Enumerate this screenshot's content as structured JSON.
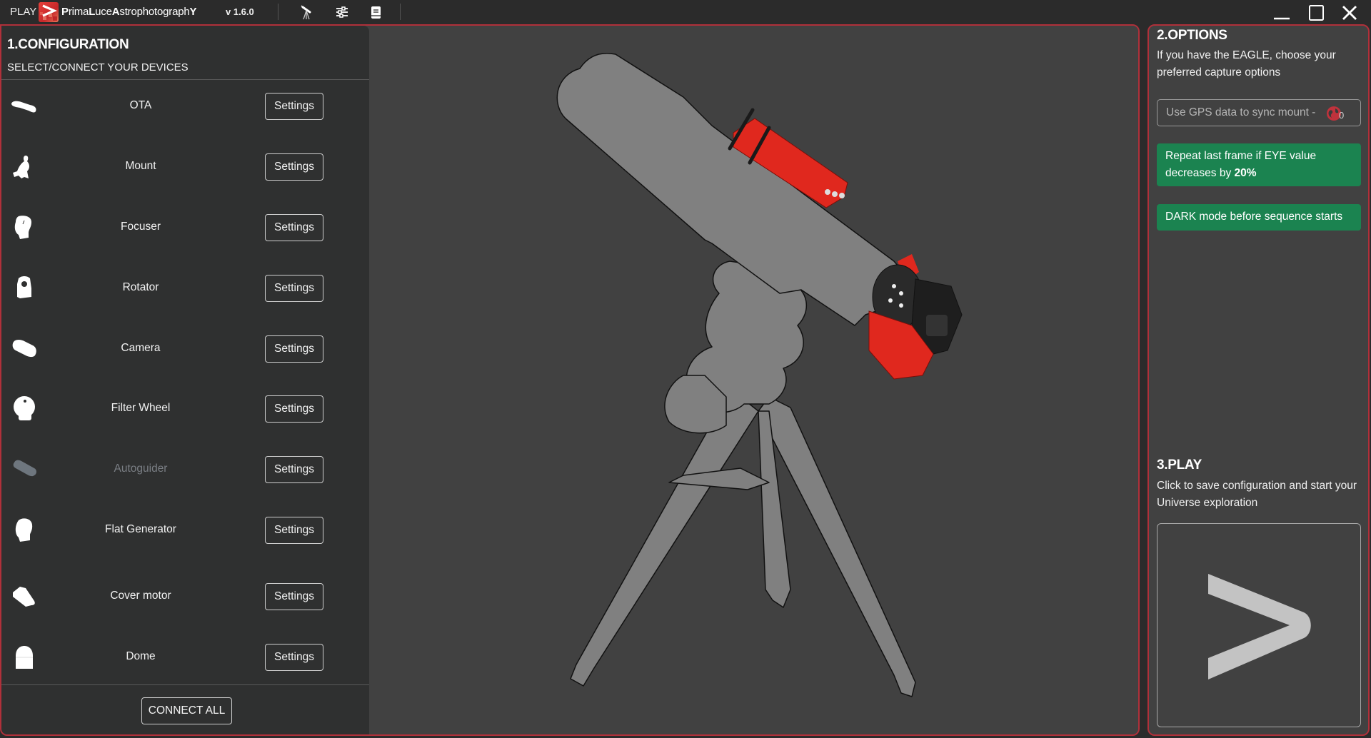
{
  "titlebar": {
    "play_label": "PLAY",
    "brand_parts": [
      {
        "text": "P",
        "bold": true
      },
      {
        "text": "rima",
        "bold": false
      },
      {
        "text": "L",
        "bold": true
      },
      {
        "text": "uce",
        "bold": false
      },
      {
        "text": "A",
        "bold": true
      },
      {
        "text": "strophotograph",
        "bold": false
      },
      {
        "text": "Y",
        "bold": true
      }
    ],
    "version": "v 1.6.0",
    "toolbar_icons": [
      "telescope-icon",
      "sliders-icon",
      "book-icon"
    ],
    "window_controls": [
      "minimize",
      "maximize",
      "close"
    ]
  },
  "configuration": {
    "title": "1.CONFIGURATION",
    "subtitle": "SELECT/CONNECT YOUR DEVICES",
    "settings_label": "Settings",
    "devices": [
      {
        "name": "OTA",
        "icon": "ota-icon",
        "enabled": true
      },
      {
        "name": "Mount",
        "icon": "mount-icon",
        "enabled": true
      },
      {
        "name": "Focuser",
        "icon": "focuser-icon",
        "enabled": true
      },
      {
        "name": "Rotator",
        "icon": "rotator-icon",
        "enabled": true
      },
      {
        "name": "Camera",
        "icon": "camera-icon",
        "enabled": true
      },
      {
        "name": "Filter Wheel",
        "icon": "filter-wheel-icon",
        "enabled": true
      },
      {
        "name": "Autoguider",
        "icon": "autoguider-icon",
        "enabled": false
      },
      {
        "name": "Flat Generator",
        "icon": "flat-generator-icon",
        "enabled": true
      },
      {
        "name": "Cover motor",
        "icon": "cover-motor-icon",
        "enabled": true
      },
      {
        "name": "Dome",
        "icon": "dome-icon",
        "enabled": true
      }
    ],
    "connect_all_label": "CONNECT ALL"
  },
  "options": {
    "title": "2.OPTIONS",
    "description": "If you have the EAGLE, choose your preferred capture options",
    "gps": {
      "label": "Use GPS data to sync mount  -",
      "icon": "globe-icon",
      "count": "0"
    },
    "repeat_frame": {
      "text": "Repeat last frame if EYE value decreases by ",
      "value": "20%"
    },
    "dark_mode": {
      "text": "DARK mode before sequence starts"
    },
    "active_color": "#1b8350"
  },
  "play": {
    "title": "3.PLAY",
    "description": "Click to save configuration and start your Universe exploration",
    "button_icon": "play-chevron-icon"
  },
  "colors": {
    "accent_border": "#b0303a",
    "equipment_red": "#e0281e",
    "silhouette": "#808080"
  }
}
